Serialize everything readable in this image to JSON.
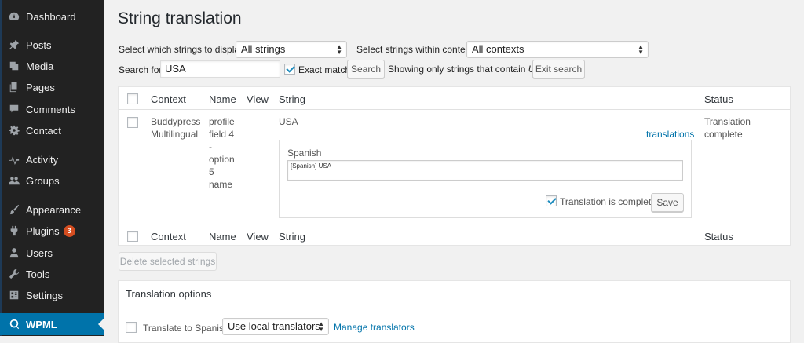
{
  "sidebar": {
    "items": [
      {
        "label": "Dashboard",
        "icon": "dashboard-icon"
      },
      {
        "label": "Posts",
        "icon": "pushpin-icon"
      },
      {
        "label": "Media",
        "icon": "media-icon"
      },
      {
        "label": "Pages",
        "icon": "pages-icon"
      },
      {
        "label": "Comments",
        "icon": "comment-icon"
      },
      {
        "label": "Contact",
        "icon": "gear-icon"
      },
      {
        "label": "Activity",
        "icon": "activity-icon"
      },
      {
        "label": "Groups",
        "icon": "groups-icon"
      },
      {
        "label": "Appearance",
        "icon": "paintbrush-icon"
      },
      {
        "label": "Plugins",
        "icon": "plugin-icon",
        "badge": "3"
      },
      {
        "label": "Users",
        "icon": "user-icon"
      },
      {
        "label": "Tools",
        "icon": "wrench-icon"
      },
      {
        "label": "Settings",
        "icon": "settings-icon"
      },
      {
        "label": "WPML",
        "icon": "wpml-icon"
      }
    ]
  },
  "page": {
    "title": "String translation"
  },
  "filters": {
    "display_label": "Select which strings to display:",
    "display_value": "All strings",
    "context_label": "Select strings within context:",
    "context_value": "All contexts",
    "search_label": "Search for:",
    "search_value": "USA",
    "exact_match_label": "Exact match",
    "search_button": "Search",
    "showing_prefix": "Showing only strings that contain",
    "showing_term": "USA",
    "exit_search_button": "Exit search"
  },
  "table": {
    "headers": {
      "context": "Context",
      "name": "Name",
      "view": "View",
      "string": "String",
      "status": "Status"
    },
    "row": {
      "context_line1": "Buddypress",
      "context_line2": "Multilingual",
      "name_lines": [
        "profile",
        "field 4",
        "-",
        "option",
        "5",
        "name"
      ],
      "string": "USA",
      "translations_link": "translations",
      "status": "Translation complete",
      "translation": {
        "language": "Spanish",
        "value": "[Spanish] USA",
        "complete_label": "Translation is complete",
        "save_button": "Save"
      }
    }
  },
  "delete_button": "Delete selected strings",
  "options": {
    "title": "Translation options",
    "translate_to_label": "Translate to Spanish",
    "translator_value": "Use local translators",
    "manage_link": "Manage translators"
  },
  "colors": {
    "accent": "#0073aa",
    "sidebar_bg": "#222222",
    "badge": "#d54e21"
  }
}
